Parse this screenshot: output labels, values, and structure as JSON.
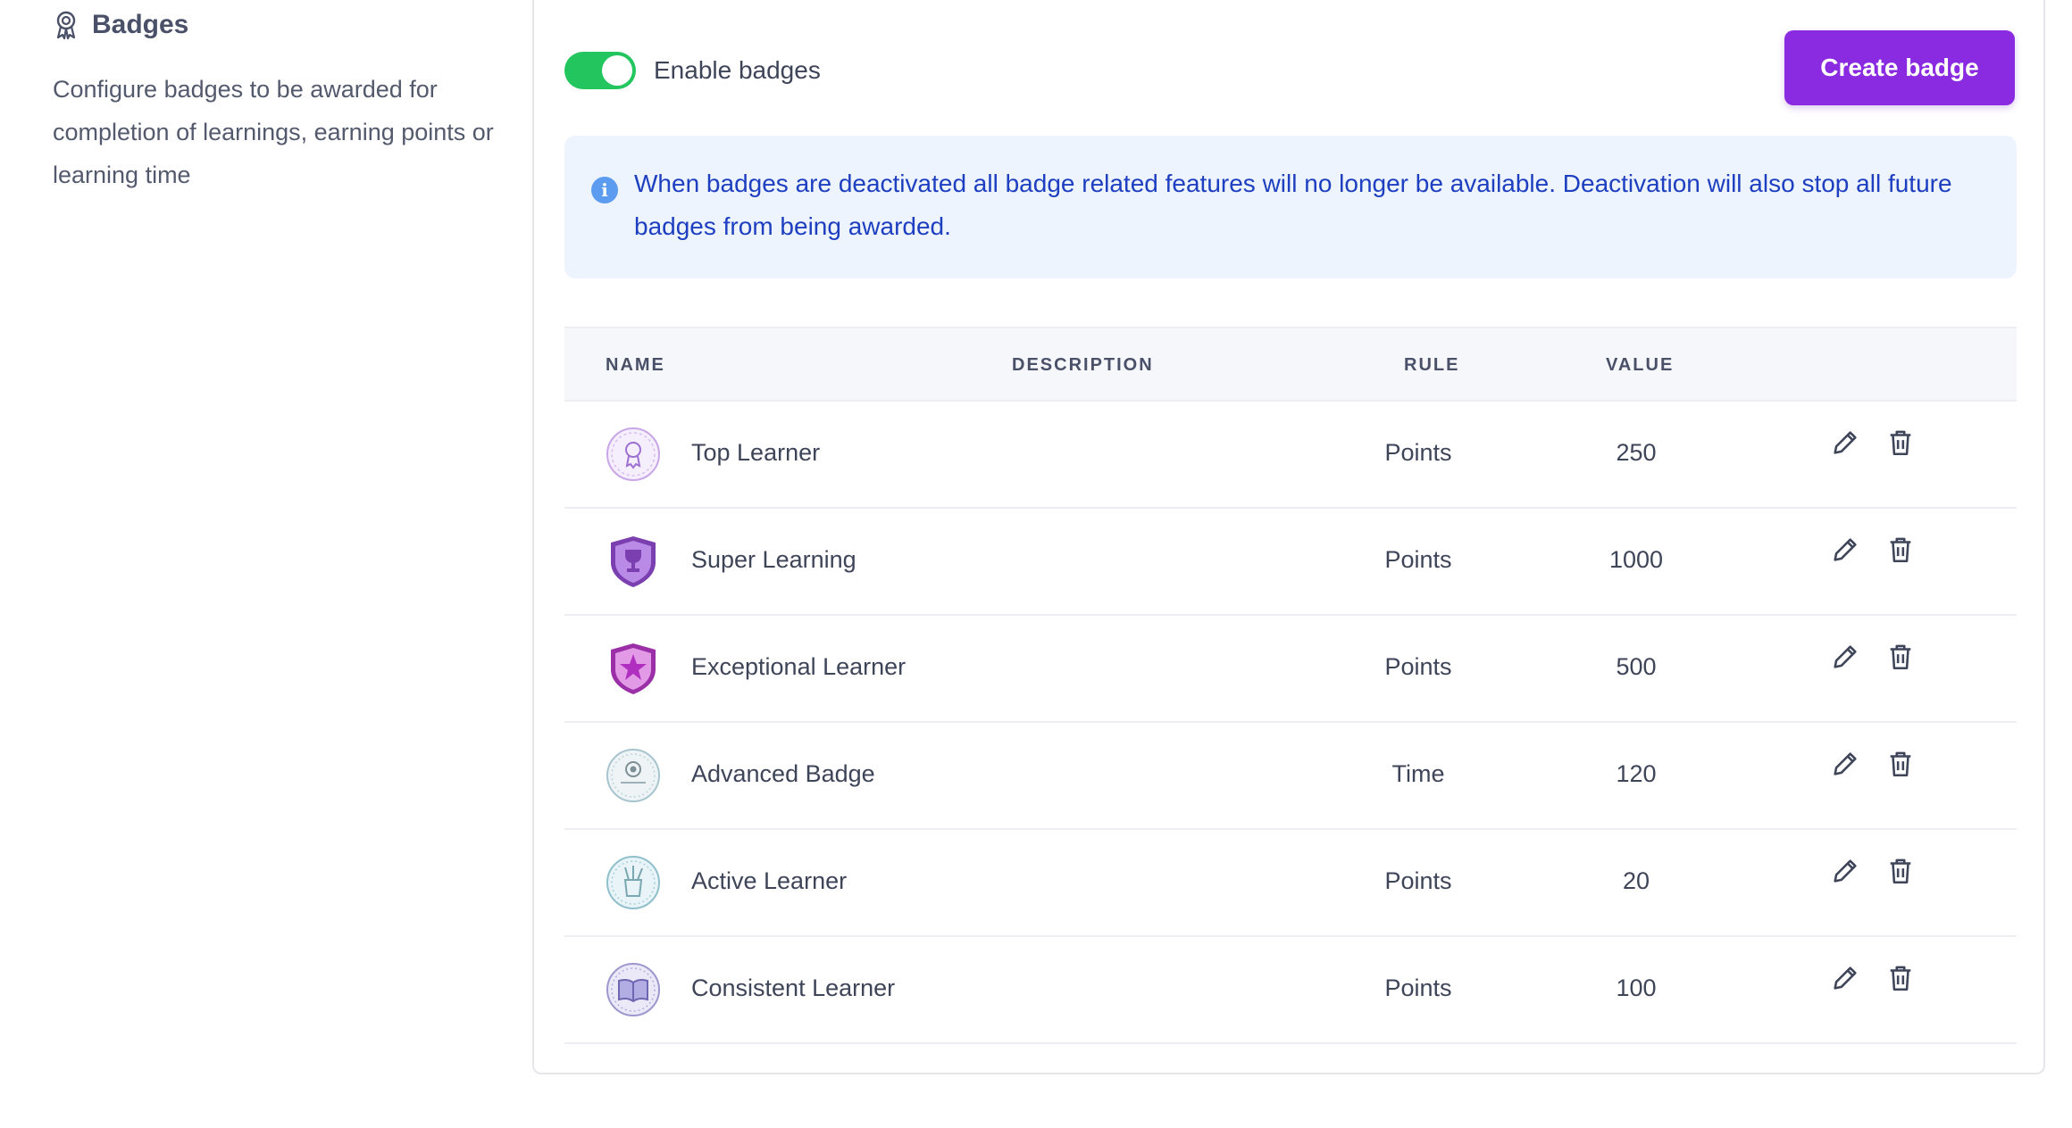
{
  "section": {
    "title": "Badges",
    "description": "Configure badges to be awarded for completion of learnings, earning points or learning time",
    "icon": "award-ribbon-icon"
  },
  "toolbar": {
    "toggle_label": "Enable badges",
    "toggle_on": true,
    "create_label": "Create badge",
    "accent_color": "#8a2be2",
    "toggle_color": "#22c55e"
  },
  "info": {
    "icon": "info-icon",
    "text": "When badges are deactivated all badge related features will no longer be available. Deactivation will also stop all future badges from being awarded."
  },
  "table": {
    "headers": {
      "name": "NAME",
      "description": "DESCRIPTION",
      "rule": "RULE",
      "value": "VALUE"
    },
    "rows": [
      {
        "name": "Top Learner",
        "description": "",
        "rule": "Points",
        "value": "250",
        "icon": "medal-badge-icon"
      },
      {
        "name": "Super Learning",
        "description": "",
        "rule": "Points",
        "value": "1000",
        "icon": "trophy-shield-badge-icon"
      },
      {
        "name": "Exceptional Learner",
        "description": "",
        "rule": "Points",
        "value": "500",
        "icon": "star-shield-badge-icon"
      },
      {
        "name": "Advanced Badge",
        "description": "",
        "rule": "Time",
        "value": "120",
        "icon": "target-badge-icon"
      },
      {
        "name": "Active Learner",
        "description": "",
        "rule": "Points",
        "value": "20",
        "icon": "pencil-cup-badge-icon"
      },
      {
        "name": "Consistent Learner",
        "description": "",
        "rule": "Points",
        "value": "100",
        "icon": "book-badge-icon"
      }
    ]
  }
}
